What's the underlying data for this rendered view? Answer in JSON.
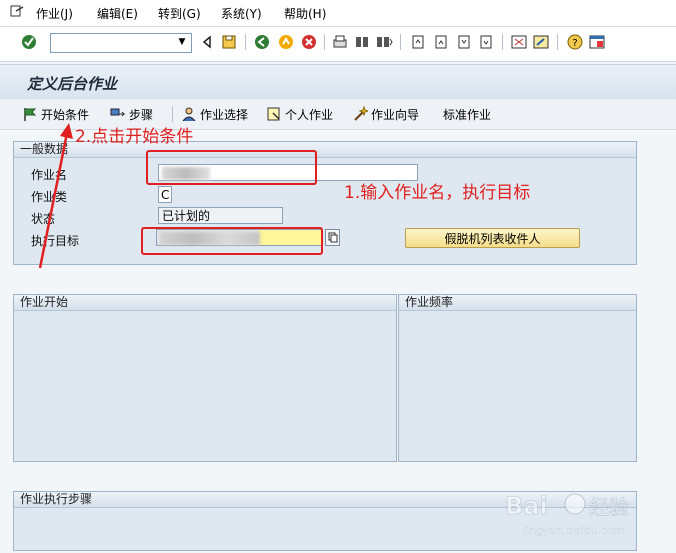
{
  "menubar": {
    "items": [
      "作业(J)",
      "编辑(E)",
      "转到(G)",
      "系统(Y)",
      "帮助(H)"
    ]
  },
  "toolbar": {
    "command_value": ""
  },
  "title": "定义后台作业",
  "app_toolbar": {
    "start_condition": "开始条件",
    "steps": "步骤",
    "job_selection": "作业选择",
    "own_jobs": "个人作业",
    "job_wizard": "作业向导",
    "standard_jobs": "标准作业"
  },
  "general_data": {
    "title": "一般数据",
    "job_name_label": "作业名",
    "job_class_label": "作业类",
    "job_class_value": "C",
    "status_label": "状态",
    "status_value": "已计划的",
    "exec_target_label": "执行目标",
    "spool_button": "假脱机列表收件人"
  },
  "job_start": {
    "title": "作业开始"
  },
  "job_frequency": {
    "title": "作业频率"
  },
  "job_steps": {
    "title": "作业执行步骤"
  },
  "annotations": {
    "step1": "1.输入作业名，执行目标",
    "step2": "2.点击开始条件"
  },
  "colors": {
    "annotation": "#e02020",
    "background": "#f3f6f9",
    "group_fill": "#dfe8f1"
  }
}
